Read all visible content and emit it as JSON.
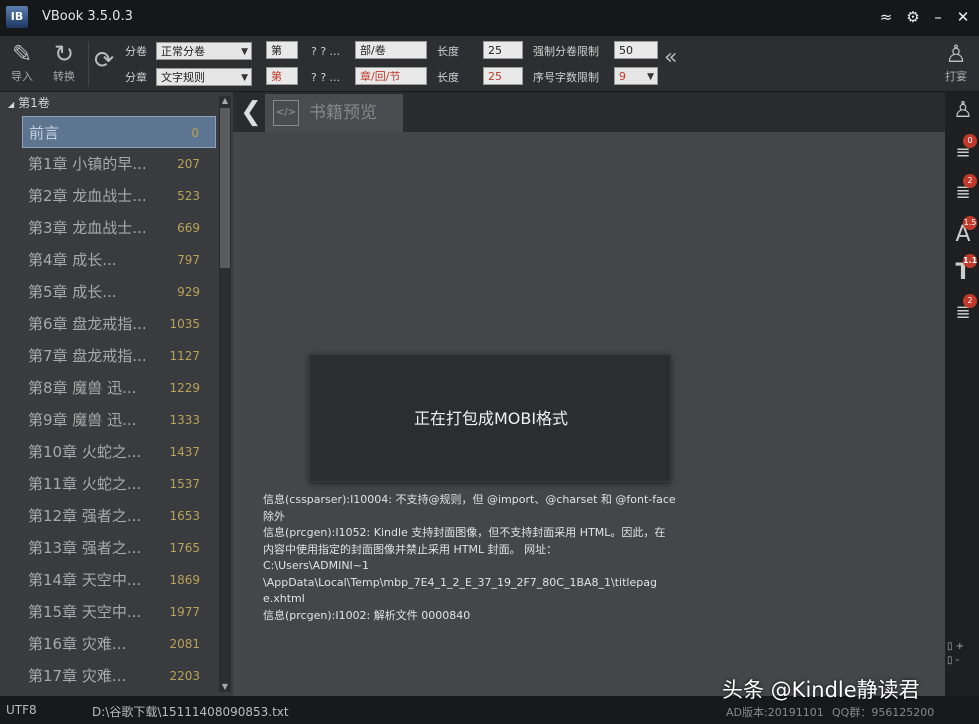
{
  "window": {
    "title": "VBook 3.5.0.3",
    "logo_text": "IB"
  },
  "titlebar_icons": [
    "wifi-icon",
    "gear-icon",
    "minimize-icon",
    "close-icon"
  ],
  "toolbar": {
    "import_label": "导入",
    "convert_label": "转换",
    "volume_label": "分卷",
    "volume_select": "正常分卷",
    "chapter_label": "分章",
    "chapter_select": "文字规则",
    "vol_prefix": "第",
    "vol_qmarks": "? ? ...",
    "vol_suffix": "部/卷",
    "ch_prefix": "第",
    "ch_qmarks": "? ? ...",
    "ch_suffix": "章/回/节",
    "length_label": "长度",
    "vol_length": "25",
    "ch_length": "25",
    "force_vol_limit_label": "强制分卷限制",
    "force_vol_limit": "50",
    "seq_limit_label": "序号字数限制",
    "seq_limit": "9",
    "package_label": "打宴"
  },
  "sidebar": {
    "volume": "第1卷",
    "chapters": [
      {
        "title": "前言",
        "count": "0"
      },
      {
        "title": "第1章 小镇的早...",
        "count": "207"
      },
      {
        "title": "第2章 龙血战士...",
        "count": "523"
      },
      {
        "title": "第3章 龙血战士...",
        "count": "669"
      },
      {
        "title": "第4章 成长...",
        "count": "797"
      },
      {
        "title": "第5章 成长...",
        "count": "929"
      },
      {
        "title": "第6章 盘龙戒指...",
        "count": "1035"
      },
      {
        "title": "第7章 盘龙戒指...",
        "count": "1127"
      },
      {
        "title": "第8章 魔兽 迅...",
        "count": "1229"
      },
      {
        "title": "第9章 魔兽 迅...",
        "count": "1333"
      },
      {
        "title": "第10章 火蛇之...",
        "count": "1437"
      },
      {
        "title": "第11章 火蛇之...",
        "count": "1537"
      },
      {
        "title": "第12章 强者之...",
        "count": "1653"
      },
      {
        "title": "第13章 强者之...",
        "count": "1765"
      },
      {
        "title": "第14章 天空中...",
        "count": "1869"
      },
      {
        "title": "第15章 天空中...",
        "count": "1977"
      },
      {
        "title": "第16章 灾难...",
        "count": "2081"
      },
      {
        "title": "第17章 灾难...",
        "count": "2203"
      }
    ]
  },
  "main": {
    "tab_label": "书籍预览",
    "tab_icon_text": "</>",
    "progress_text": "正在打包成MOBI格式",
    "log_lines": [
      "信息(cssparser):I10004: 不支持@规则，但 @import、@charset 和 @font-face",
      "除外",
      "信息(prcgen):I1052: Kindle 支持封面图像，但不支持封面采用 HTML。因此，在",
      "内容中使用指定的封面图像并禁止采用 HTML 封面。    网址：",
      "C:\\Users\\ADMINI~1",
      "\\AppData\\Local\\Temp\\mbp_7E4_1_2_E_37_19_2F7_80C_1BA8_1\\titlepag",
      "e.xhtml",
      "信息(prcgen):I1002: 解析文件  0000840"
    ]
  },
  "rightbar": {
    "badges": [
      "0",
      "2",
      "1.5",
      "1.1",
      "2"
    ]
  },
  "statusbar": {
    "encoding": "UTF8",
    "path": "D:\\谷歌下载\\15111408090853.txt",
    "version": "AD版本:20191101",
    "qq": "QQ群：956125200"
  },
  "watermark": "头条 @Kindle静读君"
}
